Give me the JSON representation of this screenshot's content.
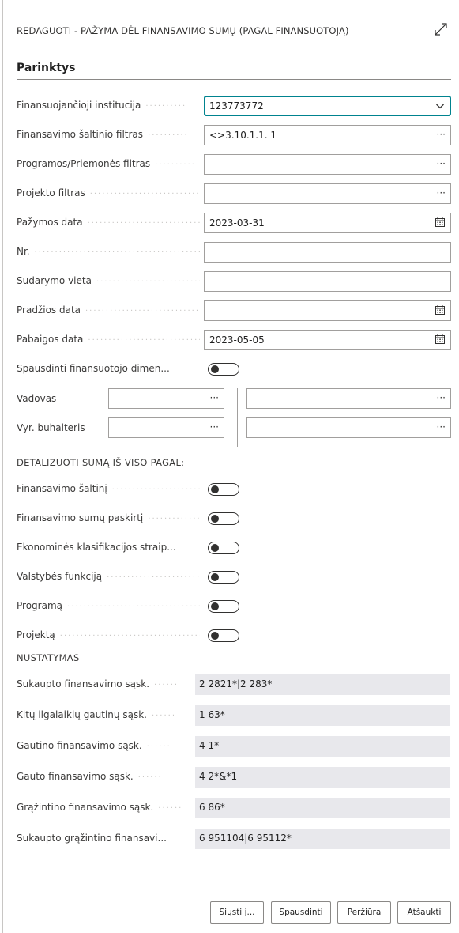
{
  "dialog": {
    "title": "REDAGUOTI - PAŽYMA DĖL FINANSAVIMO SUMŲ (PAGAL FINANSUOTOJĄ)"
  },
  "section": {
    "title": "Parinktys"
  },
  "fields": [
    {
      "label": "Finansuojančioji institucija",
      "value": "123773772",
      "control": "dropdown",
      "focused": true
    },
    {
      "label": "Finansavimo šaltinio filtras",
      "value": "<>3.10.1.1. 1",
      "control": "lookup"
    },
    {
      "label": "Programos/Priemonės filtras",
      "value": "",
      "control": "lookup"
    },
    {
      "label": "Projekto filtras",
      "value": "",
      "control": "lookup"
    },
    {
      "label": "Pažymos data",
      "value": "2023-03-31",
      "control": "date"
    },
    {
      "label": "Nr.",
      "value": "",
      "control": "text"
    },
    {
      "label": "Sudarymo vieta",
      "value": "",
      "control": "text"
    },
    {
      "label": "Pradžios data",
      "value": "",
      "control": "date"
    },
    {
      "label": "Pabaigos data",
      "value": "2023-05-05",
      "control": "date"
    }
  ],
  "print_dimensions": {
    "label": "Spausdinti finansuotojo dimen...",
    "on": false
  },
  "signatories": [
    {
      "label": "Vadovas",
      "left_value": "",
      "right_value": ""
    },
    {
      "label": "Vyr. buhalteris",
      "left_value": "",
      "right_value": ""
    }
  ],
  "lookup_button_glyph": "···",
  "detail_group": {
    "header": "DETALIZUOTI SUMĄ IŠ VISO PAGAL:",
    "toggles": [
      {
        "label": "Finansavimo šaltinį",
        "on": false
      },
      {
        "label": "Finansavimo sumų paskirtį",
        "on": false
      },
      {
        "label": "Ekonominės klasifikacijos straip...",
        "on": false
      },
      {
        "label": "Valstybės funkciją",
        "on": false
      },
      {
        "label": "Programą",
        "on": false
      },
      {
        "label": "Projektą",
        "on": false
      }
    ]
  },
  "settings_group": {
    "header": "NUSTATYMAS",
    "rows": [
      {
        "label": "Sukaupto finansavimo sąsk.",
        "value": "2 2821*|2 283*"
      },
      {
        "label": "Kitų ilgalaikių gautinų sąsk.",
        "value": "1 63*"
      },
      {
        "label": "Gautino finansavimo sąsk.",
        "value": "4 1*"
      },
      {
        "label": "Gauto finansavimo sąsk.",
        "value": "4 2*&*1"
      },
      {
        "label": "Grąžintino finansavimo sąsk.",
        "value": "6 86*"
      },
      {
        "label": "Sukaupto grąžintino finansavi...",
        "value": "6 951104|6 95112*"
      }
    ]
  },
  "footer": {
    "send_label": "Siųsti į...",
    "print_label": "Spausdinti",
    "preview_label": "Peržiūra",
    "cancel_label": "Atšaukti"
  },
  "colors": {
    "focus_border": "#00838f",
    "readonly_bg": "#e8e8ec",
    "field_border": "#a19f9d"
  },
  "icons": {
    "dropdown": "chevron-down-icon",
    "lookup": "ellipsis-icon",
    "date": "calendar-icon",
    "expand": "expand-icon"
  }
}
